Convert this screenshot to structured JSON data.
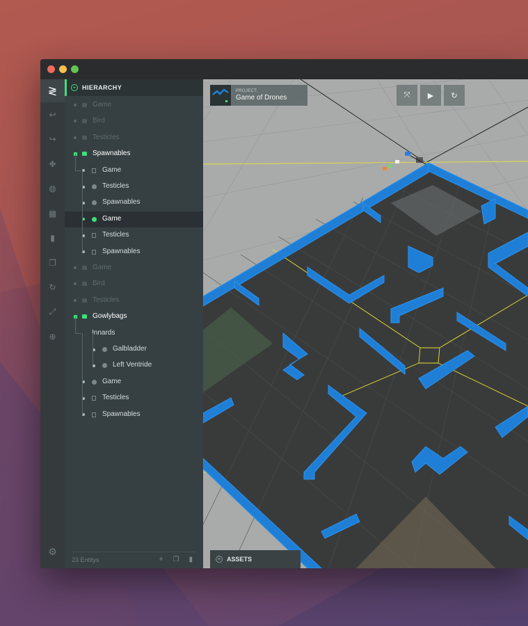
{
  "window": {
    "traffic_lights": [
      "#ed6a5e",
      "#f5c04f",
      "#61c554"
    ]
  },
  "toolbar": {
    "tools": [
      {
        "name": "logo",
        "glyph": "≷"
      },
      {
        "name": "undo-icon",
        "glyph": "↩"
      },
      {
        "name": "redo-icon",
        "glyph": "↪"
      },
      {
        "name": "move-icon",
        "glyph": "✥"
      },
      {
        "name": "globe-icon",
        "glyph": "◍"
      },
      {
        "name": "grid-icon",
        "glyph": "▦"
      },
      {
        "name": "trash-icon",
        "glyph": "▮"
      },
      {
        "name": "copy-icon",
        "glyph": "❐"
      },
      {
        "name": "rotate-icon",
        "glyph": "↻"
      },
      {
        "name": "scale-icon",
        "glyph": "⤢"
      },
      {
        "name": "zoom-icon",
        "glyph": "⊕"
      }
    ],
    "settings_glyph": "⚙"
  },
  "hierarchy": {
    "title": "HIERARCHY",
    "items": [
      {
        "label": "Game",
        "depth": 0,
        "kind": "folder",
        "state": "dim"
      },
      {
        "label": "Bird",
        "depth": 0,
        "kind": "folder",
        "state": "dim"
      },
      {
        "label": "Testicles",
        "depth": 0,
        "kind": "folder",
        "state": "dim"
      },
      {
        "label": "Spawnables",
        "depth": 0,
        "kind": "folder",
        "state": "active"
      },
      {
        "label": "Game",
        "depth": 1,
        "kind": "file",
        "state": "normal"
      },
      {
        "label": "Testicles",
        "depth": 1,
        "kind": "cube",
        "state": "normal"
      },
      {
        "label": "Spawnables",
        "depth": 1,
        "kind": "cube",
        "state": "normal"
      },
      {
        "label": "Game",
        "depth": 1,
        "kind": "cube",
        "state": "selected"
      },
      {
        "label": "Testicles",
        "depth": 1,
        "kind": "box",
        "state": "normal"
      },
      {
        "label": "Spawnables",
        "depth": 1,
        "kind": "box",
        "state": "normal"
      },
      {
        "label": "Game",
        "depth": 0,
        "kind": "folder",
        "state": "dim"
      },
      {
        "label": "Bird",
        "depth": 0,
        "kind": "folder",
        "state": "dim"
      },
      {
        "label": "Testicles",
        "depth": 0,
        "kind": "folder",
        "state": "dim"
      },
      {
        "label": "Gowlybags",
        "depth": 0,
        "kind": "folder",
        "state": "active"
      },
      {
        "label": "Innards",
        "depth": 1,
        "kind": "none",
        "state": "normal"
      },
      {
        "label": "Galbladder",
        "depth": 2,
        "kind": "cube",
        "state": "normal"
      },
      {
        "label": "Left Ventride",
        "depth": 2,
        "kind": "cube",
        "state": "normal"
      },
      {
        "label": "Game",
        "depth": 1,
        "kind": "cube",
        "state": "normal"
      },
      {
        "label": "Testicles",
        "depth": 1,
        "kind": "box",
        "state": "normal"
      },
      {
        "label": "Spawnables",
        "depth": 1,
        "kind": "box",
        "state": "normal"
      }
    ],
    "footer": {
      "count": "23 Entitys",
      "add_glyph": "+",
      "copy_glyph": "❐",
      "delete_glyph": "▮"
    }
  },
  "viewport": {
    "project_label": "PROJECT:",
    "project_name": "Game of Drones",
    "buttons": [
      {
        "name": "fullscreen-icon",
        "glyph": "⤧"
      },
      {
        "name": "play-icon",
        "glyph": "▶"
      },
      {
        "name": "refresh-icon",
        "glyph": "↻"
      }
    ],
    "assets_label": "ASSETS",
    "colors": {
      "wall": "#1f7fd6",
      "wall_top": "#2d92ec",
      "floor": "#393b3b",
      "ground": "#a9abab",
      "accent": "#3ee07a",
      "guide": "#e8e233"
    }
  }
}
